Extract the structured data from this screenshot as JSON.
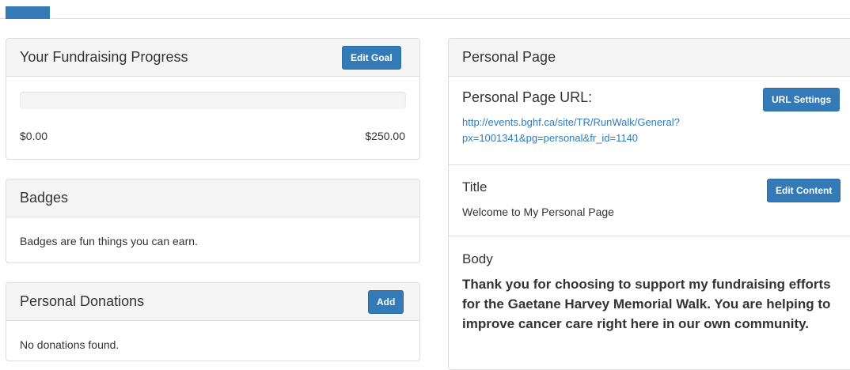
{
  "fundraising": {
    "title": "Your Fundraising Progress",
    "edit_goal_label": "Edit Goal",
    "progress_fraction": 0,
    "raised": "$0.00",
    "goal": "$250.00"
  },
  "badges": {
    "title": "Badges",
    "text": "Badges are fun things you can earn."
  },
  "donations": {
    "title": "Personal Donations",
    "add_label": "Add",
    "empty_text": "No donations found."
  },
  "personal_page": {
    "title": "Personal Page",
    "url_label": "Personal Page URL:",
    "url_settings_label": "URL Settings",
    "url_line1": "http://events.bghf.ca/site/TR/RunWalk/General?",
    "url_line2": "px=1001341&pg=personal&fr_id=1140",
    "title_label": "Title",
    "edit_content_label": "Edit Content",
    "title_value": "Welcome to My Personal Page",
    "body_label": "Body",
    "body_text": "Thank you for choosing to support my fundraising efforts for the Gaetane Harvey Memorial Walk.  You are helping to improve cancer care right here in our own community."
  },
  "colors": {
    "primary": "#337ab7",
    "panel_heading_bg": "#f5f5f5",
    "border": "#dddddd"
  }
}
